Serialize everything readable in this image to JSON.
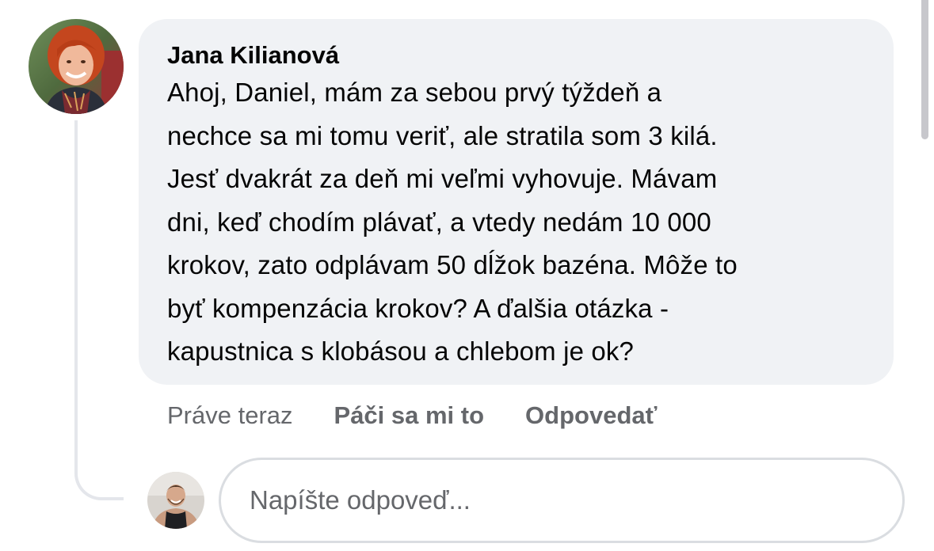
{
  "comment": {
    "author": "Jana Kilianová",
    "text": "Ahoj, Daniel, mám za sebou prvý týždeň a\nnechce sa mi tomu veriť, ale stratila som 3 kilá.\nJesť dvakrát za deň mi veľmi vyhovuje. Mávam\ndni, keď chodím plávať, a vtedy nedám 10 000\nkrokov, zato odplávam 50 dĺžok bazéna. Môže to\nbyť kompenzácia krokov? A ďalšia otázka -\nkapustnica s klobásou a chlebom je ok?",
    "timestamp": "Práve teraz",
    "like_label": "Páči sa mi to",
    "reply_label": "Odpovedať"
  },
  "reply": {
    "placeholder": "Napíšte odpoveď..."
  },
  "colors": {
    "bubble": "#f0f2f5",
    "secondary_text": "#65676b",
    "primary_text": "#050505",
    "input_border": "#dadde1",
    "thread_line": "#e4e6eb"
  },
  "icons": {
    "author_avatar": "profile-photo",
    "user_avatar": "profile-photo"
  }
}
